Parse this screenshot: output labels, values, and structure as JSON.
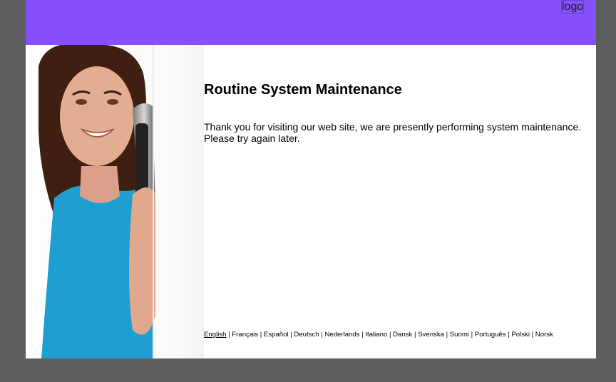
{
  "header": {
    "logo_label": "logo",
    "background": "#8650fa"
  },
  "main": {
    "title": "Routine System Maintenance",
    "message_line1": "Thank you for visiting our web site, we are presently performing system maintenance.",
    "message_line2": "Please try again later."
  },
  "languages": {
    "separator": "|",
    "items": [
      {
        "label": "English",
        "active": true
      },
      {
        "label": "Français",
        "active": false
      },
      {
        "label": "Español",
        "active": false
      },
      {
        "label": "Deutsch",
        "active": false
      },
      {
        "label": "Nederlands",
        "active": false
      },
      {
        "label": "Italiano",
        "active": false
      },
      {
        "label": "Dansk",
        "active": false
      },
      {
        "label": "Svenska",
        "active": false
      },
      {
        "label": "Suomi",
        "active": false
      },
      {
        "label": "Português",
        "active": false
      },
      {
        "label": "Polski",
        "active": false
      },
      {
        "label": "Norsk",
        "active": false
      }
    ]
  },
  "colors": {
    "page_background": "#5e5e5e",
    "shirt": "#1f9fd1",
    "hair": "#3e1f12",
    "skin": "#e3ad92"
  }
}
